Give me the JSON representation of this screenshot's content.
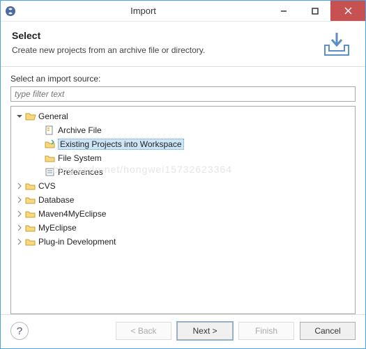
{
  "window": {
    "title": "Import"
  },
  "header": {
    "title": "Select",
    "description": "Create new projects from an archive file or directory."
  },
  "body": {
    "source_label": "Select an import source:",
    "filter_placeholder": "type filter text"
  },
  "tree": {
    "general": {
      "label": "General",
      "expanded": true
    },
    "archive_file": {
      "label": "Archive File"
    },
    "existing_projects": {
      "label": "Existing Projects into Workspace",
      "selected": true
    },
    "file_system": {
      "label": "File System"
    },
    "preferences": {
      "label": "Preferences"
    },
    "cvs": {
      "label": "CVS"
    },
    "database": {
      "label": "Database"
    },
    "maven4myeclipse": {
      "label": "Maven4MyEclipse"
    },
    "myeclipse": {
      "label": "MyEclipse"
    },
    "plugin_dev": {
      "label": "Plug-in Development"
    }
  },
  "buttons": {
    "back": "< Back",
    "next": "Next >",
    "finish": "Finish",
    "cancel": "Cancel",
    "help": "?"
  },
  "watermark": "blog.csdn.net/hongwei15732623364"
}
